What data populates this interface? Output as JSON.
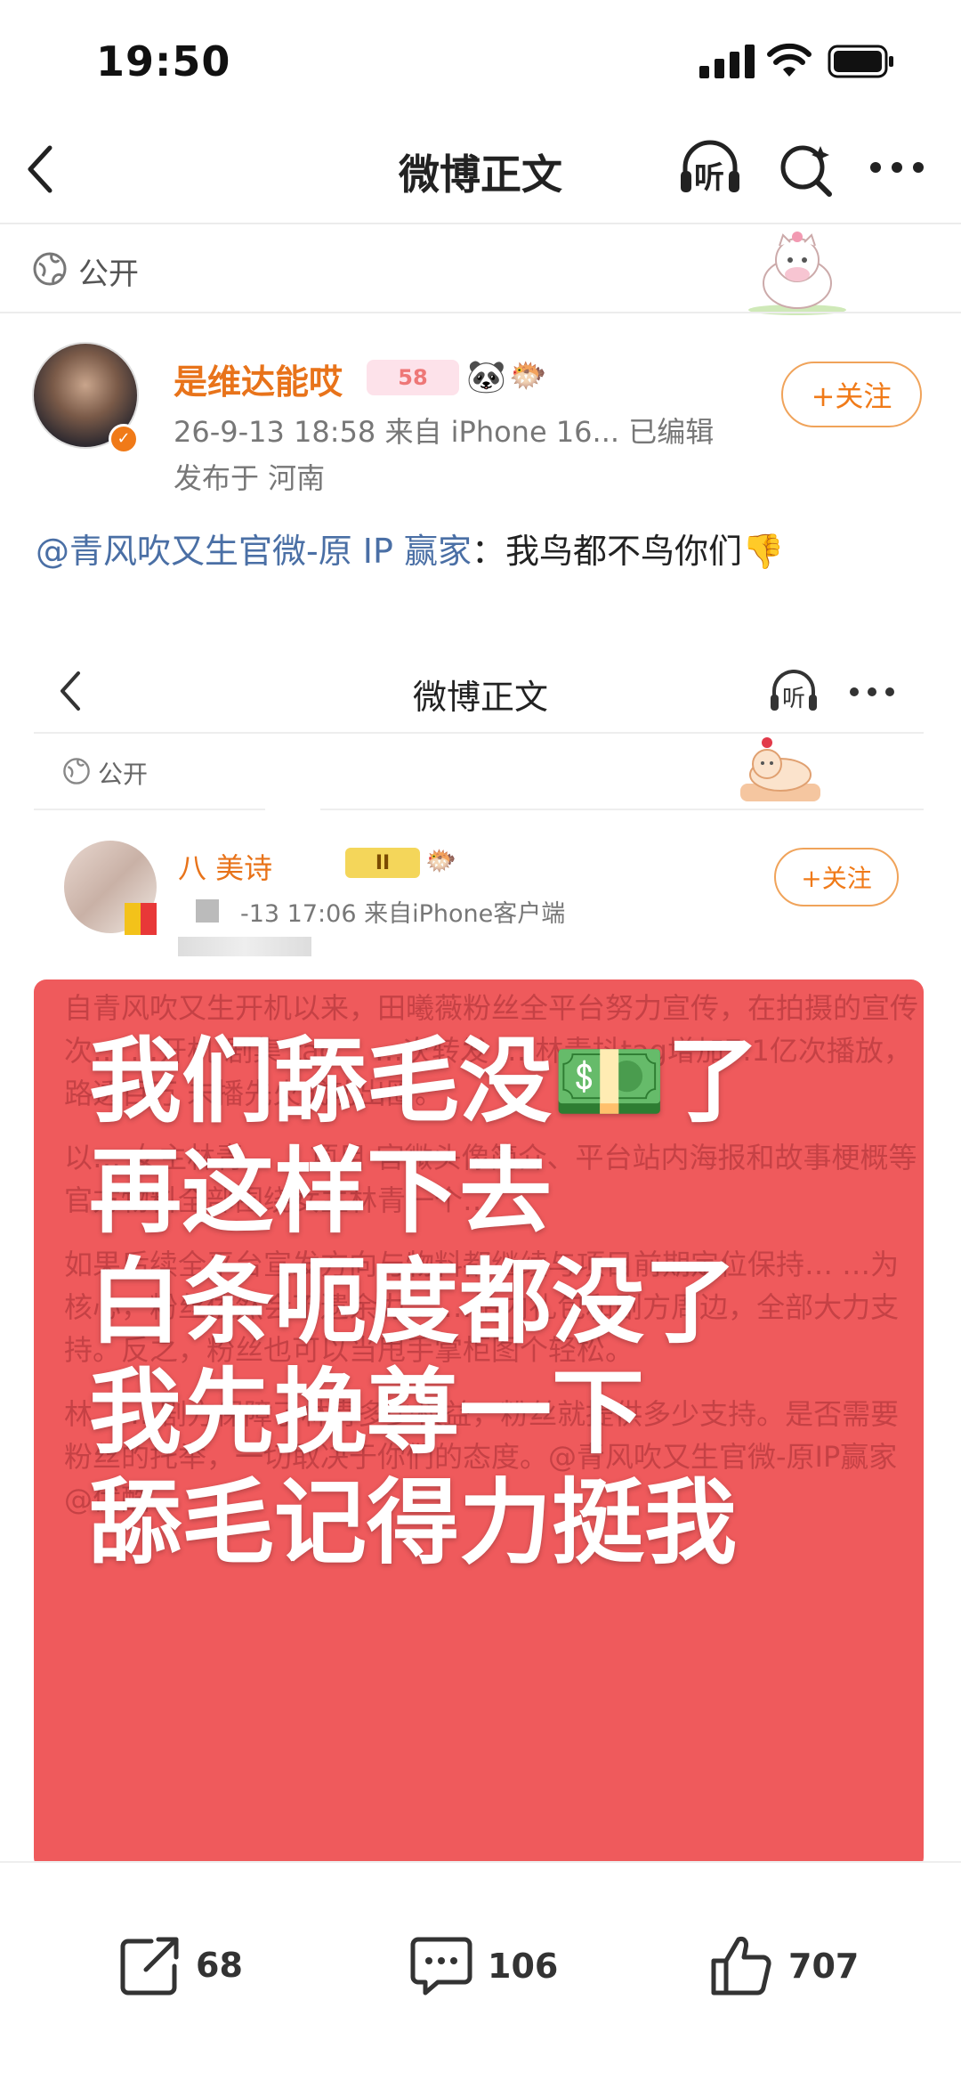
{
  "status_bar": {
    "time": "19:50"
  },
  "nav": {
    "title": "微博正文",
    "listen_label": "听"
  },
  "visibility": {
    "label": "公开"
  },
  "author": {
    "name": "是维达能哎",
    "badge_text": "58",
    "meta": "26-9-13 18:58  来自 iPhone 16...  已编辑",
    "location": "发布于 河南",
    "follow_label": "+关注"
  },
  "post": {
    "mention": "@青风吹又生官微-原 IP 赢家",
    "colon": "：",
    "text": "我鸟都不鸟你们👎"
  },
  "embedded": {
    "title": "微博正文",
    "listen_label": "听",
    "visibility": "公开",
    "author_name": "八    美诗",
    "badge_text": "II",
    "meta": "-13 17:06  来自iPhone客户端",
    "follow_label": "+关注",
    "overlay_lines": [
      "我们舔毛没💵了",
      "再这样下去",
      "白条呃度都没了",
      "我先挽尊一下",
      "舔毛记得力挺我"
    ],
    "background_paragraphs": [
      "自青风吹又生开机以来，田曦薇粉丝全平台努力宣传，在拍摄的宣传次…  …开机  剧集  tag… …次转发 … 林青抖tag增加7.1亿次播放，路透百万  未播先火成功出圈。",
      "以… 女主林青…  …项目 官微头像简介、平台站内海报和故事梗概等官方物料全部围绕女主林青一个…",
      "如果后续全平台宣发方向与物料都继续与项目前期定位保持…  …为核心，粉丝依然会不遗余力…  …站内礼包和剧方周边，全部大力支持。反之，粉丝也可以当甩手掌柜图个轻松。",
      "林…  …剧方保障了林青多少权益，粉丝就提供多少支持。是否需要粉丝的托举，一切取决于你们的态度。@青风吹又生官微-原IP赢家 @优酷"
    ]
  },
  "actions": {
    "share_count": "68",
    "comment_count": "106",
    "like_count": "707"
  },
  "colors": {
    "accent_orange": "#f07a18",
    "mention_blue": "#4a6fa5",
    "card_red": "#ef5a5c"
  }
}
